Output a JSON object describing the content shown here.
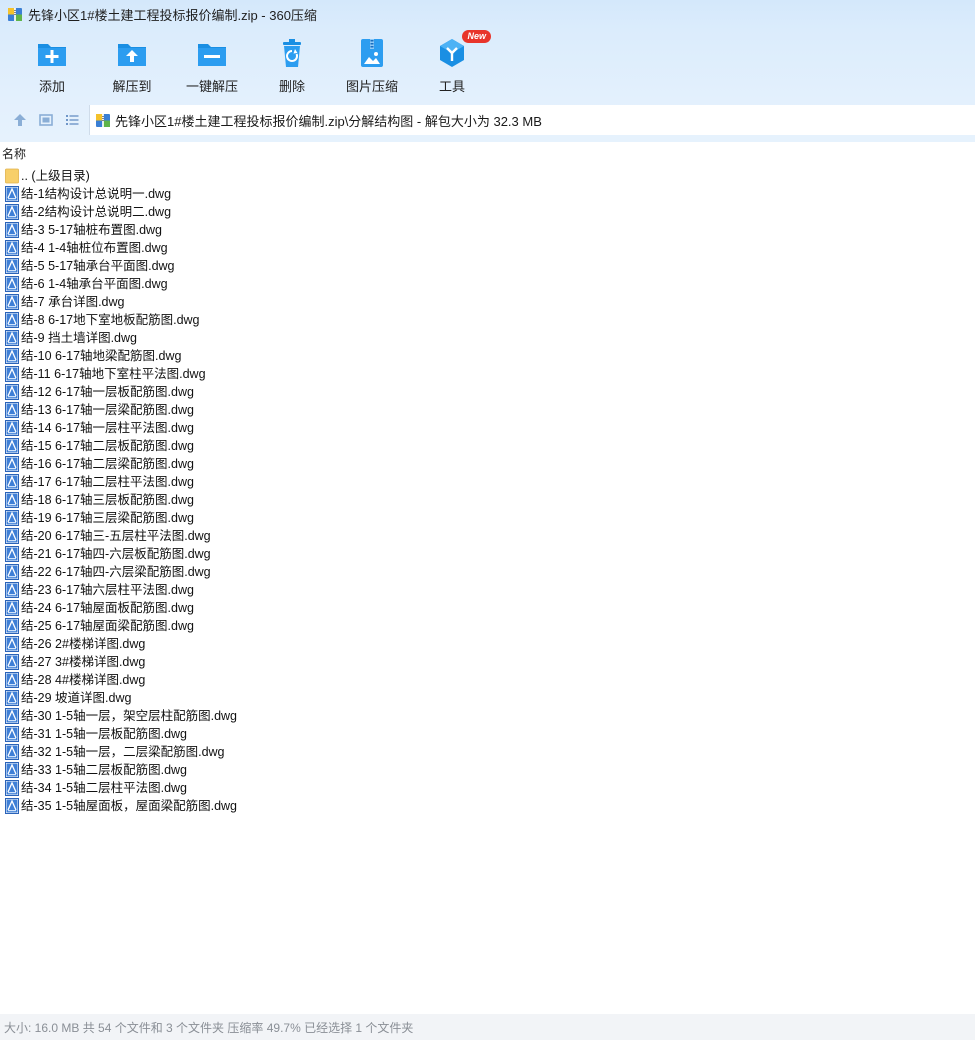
{
  "window": {
    "title": "先锋小区1#楼土建工程投标报价编制.zip - 360压缩"
  },
  "toolbar": {
    "buttons": [
      {
        "label": "添加",
        "icon": "add-icon"
      },
      {
        "label": "解压到",
        "icon": "extract-to-icon"
      },
      {
        "label": "一键解压",
        "icon": "one-click-extract-icon"
      },
      {
        "label": "删除",
        "icon": "delete-icon"
      },
      {
        "label": "图片压缩",
        "icon": "image-compress-icon"
      },
      {
        "label": "工具",
        "icon": "tools-icon",
        "badge": "New"
      }
    ]
  },
  "address": {
    "path": "先锋小区1#楼土建工程投标报价编制.zip\\分解结构图 - 解包大小为 32.3 MB"
  },
  "list": {
    "column_name": "名称",
    "parent_entry": ".. (上级目录)",
    "files": [
      "结-1结构设计总说明一.dwg",
      "结-2结构设计总说明二.dwg",
      "结-3 5-17轴桩布置图.dwg",
      "结-4 1-4轴桩位布置图.dwg",
      "结-5 5-17轴承台平面图.dwg",
      "结-6 1-4轴承台平面图.dwg",
      "结-7 承台详图.dwg",
      "结-8 6-17地下室地板配筋图.dwg",
      "结-9 挡土墙详图.dwg",
      "结-10 6-17轴地梁配筋图.dwg",
      "结-11 6-17轴地下室柱平法图.dwg",
      "结-12 6-17轴一层板配筋图.dwg",
      "结-13 6-17轴一层梁配筋图.dwg",
      "结-14 6-17轴一层柱平法图.dwg",
      "结-15 6-17轴二层板配筋图.dwg",
      "结-16 6-17轴二层梁配筋图.dwg",
      "结-17 6-17轴二层柱平法图.dwg",
      "结-18 6-17轴三层板配筋图.dwg",
      "结-19 6-17轴三层梁配筋图.dwg",
      "结-20 6-17轴三-五层柱平法图.dwg",
      "结-21 6-17轴四-六层板配筋图.dwg",
      "结-22 6-17轴四-六层梁配筋图.dwg",
      "结-23 6-17轴六层柱平法图.dwg",
      "结-24 6-17轴屋面板配筋图.dwg",
      "结-25 6-17轴屋面梁配筋图.dwg",
      "结-26 2#楼梯详图.dwg",
      "结-27 3#楼梯详图.dwg",
      "结-28 4#楼梯详图.dwg",
      "结-29 坡道详图.dwg",
      "结-30 1-5轴一层，架空层柱配筋图.dwg",
      "结-31 1-5轴一层板配筋图.dwg",
      "结-32 1-5轴一层，二层梁配筋图.dwg",
      "结-33 1-5轴二层板配筋图.dwg",
      "结-34 1-5轴二层柱平法图.dwg",
      "结-35 1-5轴屋面板，屋面梁配筋图.dwg"
    ]
  },
  "status": {
    "text": "大小: 16.0 MB 共 54 个文件和 3 个文件夹 压缩率 49.7% 已经选择 1 个文件夹"
  },
  "colors": {
    "accent": "#1a8fe3",
    "chrome_bg": "#dbecfc",
    "badge": "#e8352b",
    "folder": "#f7cf6a",
    "status_text": "#8a8f96"
  }
}
